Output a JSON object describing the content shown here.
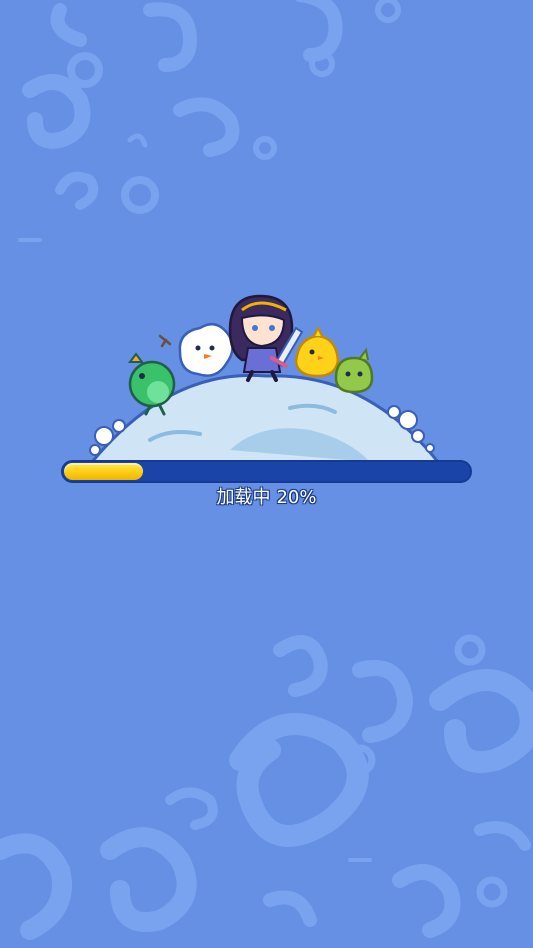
{
  "loading": {
    "label": "加载中",
    "percent_text": "20%",
    "progress": 0.2
  },
  "colors": {
    "background": "#6590e3",
    "track": "#1a44a8",
    "fill": "#ffd21a",
    "planet": "#cfe4f5"
  },
  "icons": [
    "swirl-pattern",
    "hero-girl",
    "sword",
    "snowman",
    "green-bird",
    "yellow-chick",
    "green-blob",
    "ice-planet"
  ]
}
